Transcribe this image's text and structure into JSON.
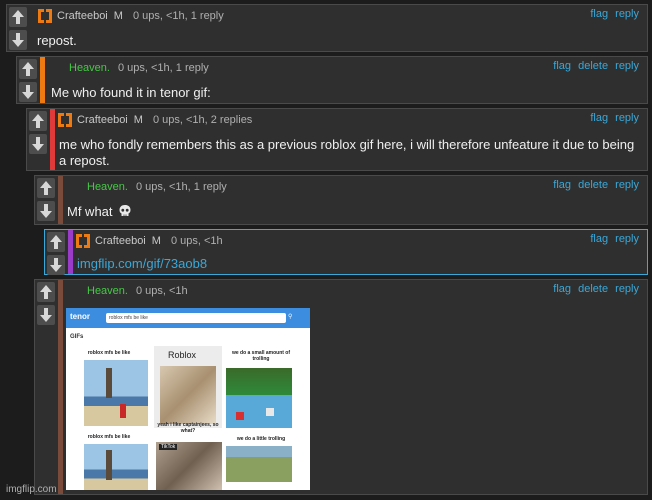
{
  "comments": [
    {
      "user": "Crafteeboi",
      "badge": "M",
      "meta": "0 ups, <1h, 1 reply",
      "actions": [
        "flag",
        "reply"
      ],
      "text": "repost."
    },
    {
      "user": "Heaven.",
      "meta": "0 ups, <1h, 1 reply",
      "actions": [
        "flag",
        "delete",
        "reply"
      ],
      "text": "Me who found it in tenor gif:"
    },
    {
      "user": "Crafteeboi",
      "badge": "M",
      "meta": "0 ups, <1h, 2 replies",
      "actions": [
        "flag",
        "reply"
      ],
      "text": "me who fondly remembers this as a previous roblox gif here, i will therefore unfeature it due to being a repost."
    },
    {
      "user": "Heaven.",
      "meta": "0 ups, <1h, 1 reply",
      "actions": [
        "flag",
        "delete",
        "reply"
      ],
      "text": "Mf what"
    },
    {
      "user": "Crafteeboi",
      "badge": "M",
      "meta": "0 ups, <1h",
      "actions": [
        "flag",
        "reply"
      ],
      "text": "imgflip.com/gif/73aob8"
    },
    {
      "user": "Heaven.",
      "meta": "0 ups, <1h",
      "actions": [
        "flag",
        "delete",
        "reply"
      ],
      "text": ""
    }
  ],
  "gif": {
    "brand": "tenor",
    "search": "roblox mfs be like",
    "section": "GIFs",
    "cap1": "roblox mfs be like",
    "cap2": "Roblox",
    "cap3": "we do a small amount of trolling",
    "cap4": "yeah i like captainjees, so what?",
    "cap5": "roblox mfs be like",
    "cap6": "we do a little trolling",
    "cap7": "TikTok"
  },
  "watermark": "imgflip.com",
  "colors": {
    "orange": "#f07a12",
    "green": "#46c846",
    "link": "#3aa8d8",
    "red": "#e03a3a",
    "purple": "#9a3cc8",
    "brown": "#7a4a3a"
  }
}
